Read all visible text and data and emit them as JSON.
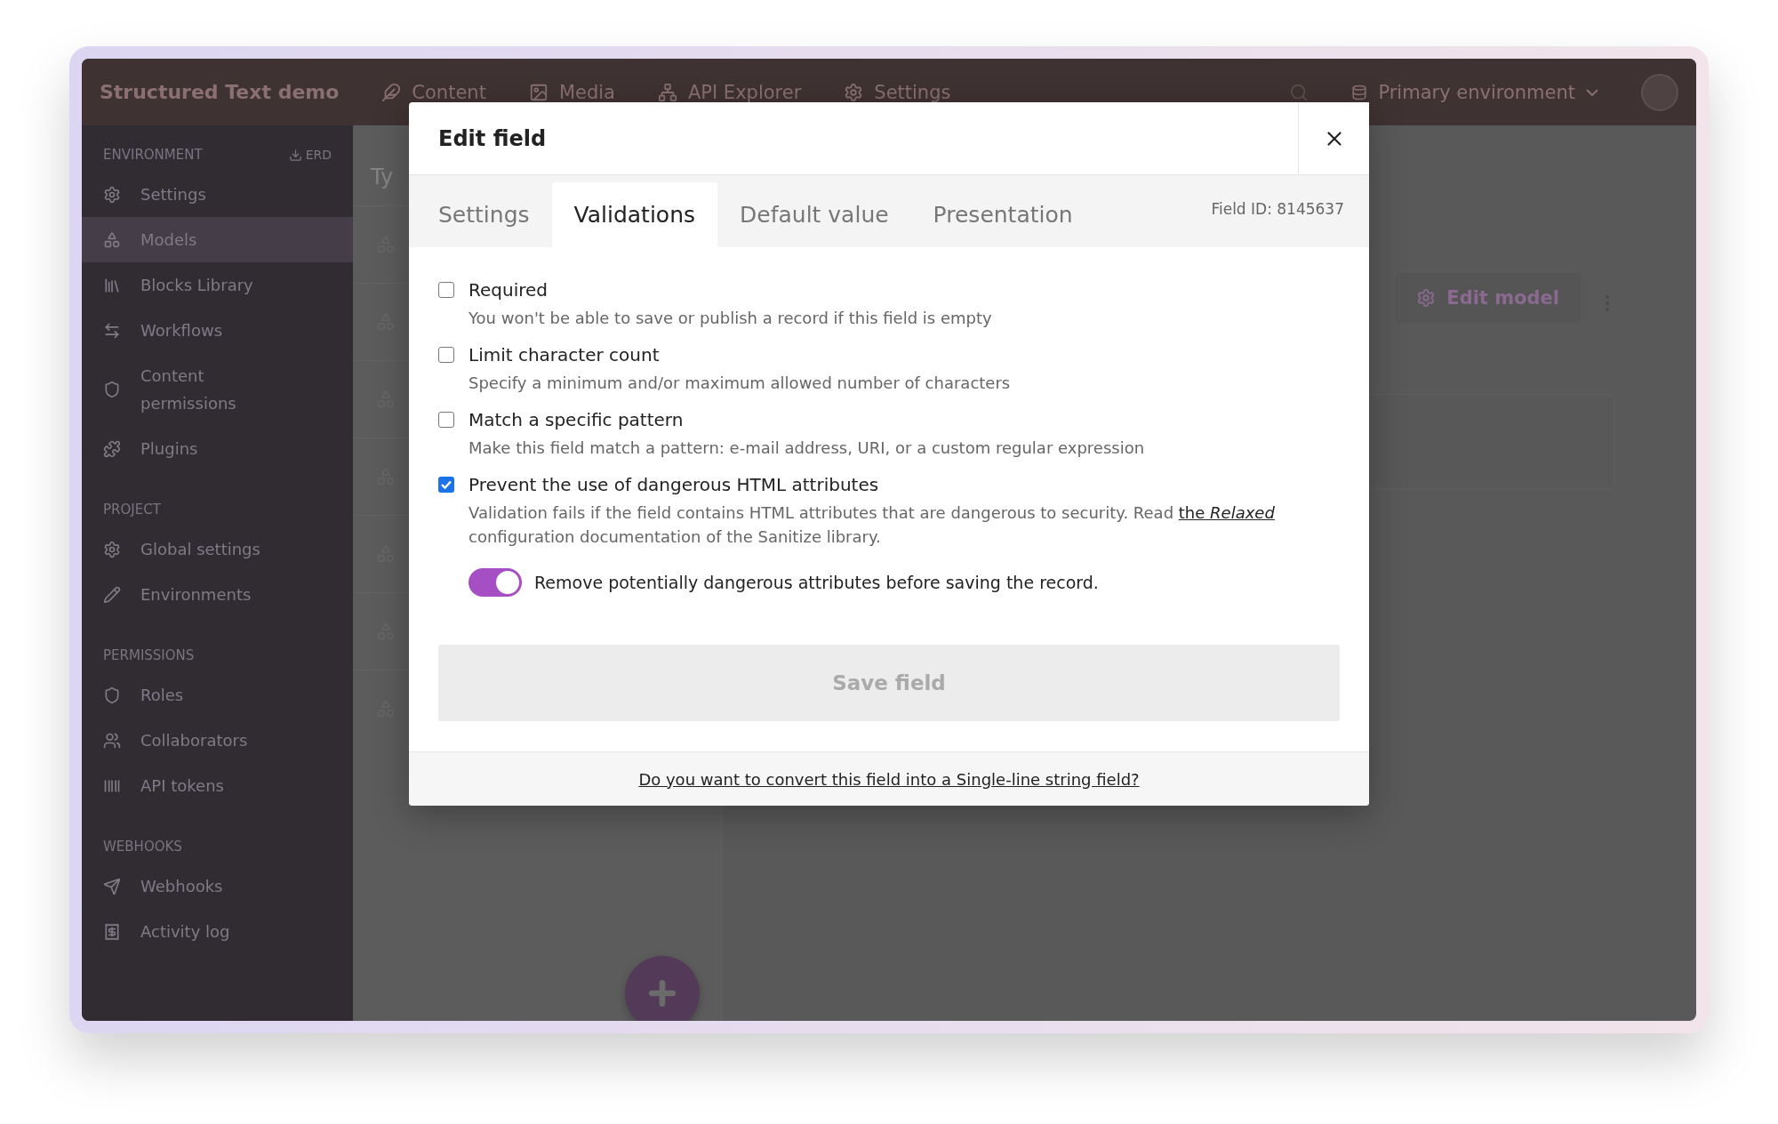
{
  "topbar": {
    "title": "Structured Text demo",
    "nav": [
      {
        "label": "Content"
      },
      {
        "label": "Media"
      },
      {
        "label": "API Explorer"
      },
      {
        "label": "Settings"
      }
    ],
    "environment": "Primary environment"
  },
  "sidebar": {
    "sections": [
      {
        "heading": "ENVIRONMENT",
        "action": "ERD",
        "items": [
          {
            "label": "Settings",
            "selected": false
          },
          {
            "label": "Models",
            "selected": true
          },
          {
            "label": "Blocks Library",
            "selected": false
          },
          {
            "label": "Workflows",
            "selected": false
          },
          {
            "label": "Content permissions",
            "selected": false
          },
          {
            "label": "Plugins",
            "selected": false
          }
        ]
      },
      {
        "heading": "PROJECT",
        "items": [
          {
            "label": "Global settings",
            "selected": false
          },
          {
            "label": "Environments",
            "selected": false
          }
        ]
      },
      {
        "heading": "PERMISSIONS",
        "items": [
          {
            "label": "Roles",
            "selected": false
          },
          {
            "label": "Collaborators",
            "selected": false
          },
          {
            "label": "API tokens",
            "selected": false
          }
        ]
      },
      {
        "heading": "WEBHOOKS",
        "items": [
          {
            "label": "Webhooks",
            "selected": false
          },
          {
            "label": "Activity log",
            "selected": false
          }
        ]
      }
    ]
  },
  "background": {
    "column_heading": "Ty",
    "edit_model": "Edit model"
  },
  "modal": {
    "title": "Edit field",
    "tabs": [
      {
        "label": "Settings",
        "selected": false
      },
      {
        "label": "Validations",
        "selected": true
      },
      {
        "label": "Default value",
        "selected": false
      },
      {
        "label": "Presentation",
        "selected": false
      }
    ],
    "field_id": "Field ID: 8145637",
    "validations": [
      {
        "label": "Required",
        "checked": false,
        "description": "You won't be able to save or publish a record if this field is empty"
      },
      {
        "label": "Limit character count",
        "checked": false,
        "description": "Specify a minimum and/or maximum allowed number of characters"
      },
      {
        "label": "Match a specific pattern",
        "checked": false,
        "description": "Make this field match a pattern: e-mail address, URI, or a custom regular expression"
      },
      {
        "label": "Prevent the use of dangerous HTML attributes",
        "checked": true,
        "description": "Validation fails if the field contains HTML attributes that are dangerous to security. Read",
        "link": "the *Relaxed*",
        "description_end": "configuration documentation of the Sanitize library.",
        "toggle": {
          "label": "Remove potentially dangerous attributes before saving the record.",
          "on": true
        }
      }
    ],
    "save_button": "Save field",
    "footer_link": "Do you want to convert this field into a Single-line string field?"
  }
}
